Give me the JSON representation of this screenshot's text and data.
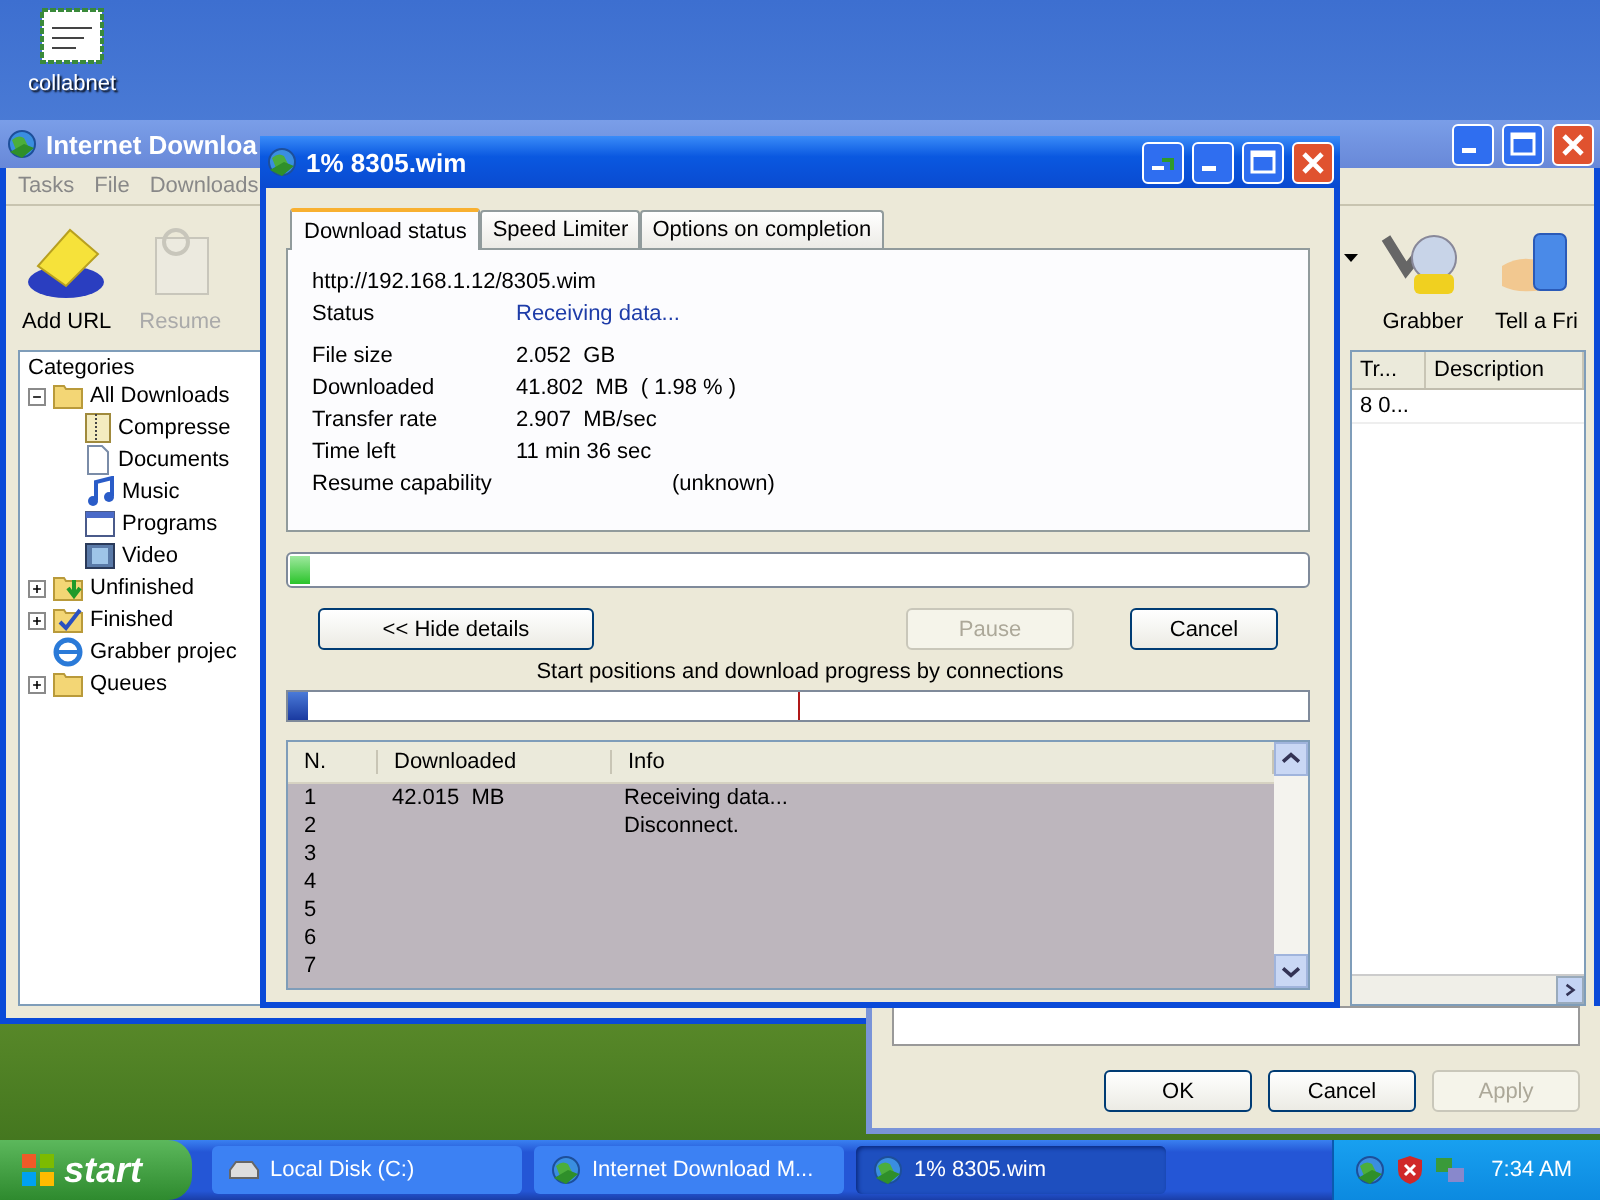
{
  "desktop_icons": [
    {
      "label": "collabnet"
    }
  ],
  "main_window": {
    "title": "Internet Downloa",
    "menu": [
      "Tasks",
      "File",
      "Downloads"
    ],
    "toolbar_left": [
      {
        "label": "Add URL",
        "disabled": false
      },
      {
        "label": "Resume",
        "disabled": true
      }
    ],
    "toolbar_right": [
      {
        "label": "Grabber",
        "disabled": false
      },
      {
        "label": "Tell a Fri",
        "disabled": false
      }
    ],
    "categories_title": "Categories",
    "tree": [
      {
        "label": "All Downloads",
        "expanded": true,
        "children": [
          {
            "label": "Compresse"
          },
          {
            "label": "Documents"
          },
          {
            "label": "Music"
          },
          {
            "label": "Programs"
          },
          {
            "label": "Video"
          }
        ]
      },
      {
        "label": "Unfinished",
        "expanded": false
      },
      {
        "label": "Finished",
        "expanded": false
      },
      {
        "label": "Grabber projec"
      },
      {
        "label": "Queues",
        "expanded": false
      }
    ],
    "list_columns": [
      "Tr...",
      "Description"
    ],
    "list_rows": [
      "8 0..."
    ]
  },
  "download_dialog": {
    "title": "1% 8305.wim",
    "tabs": [
      {
        "label": "Download status",
        "selected": true
      },
      {
        "label": "Speed Limiter",
        "selected": false
      },
      {
        "label": "Options on completion",
        "selected": false
      }
    ],
    "url": "http://192.168.1.12/8305.wim",
    "status_label": "Status",
    "status_value": "Receiving data...",
    "fields": [
      {
        "label": "File size",
        "value": "2.052  GB"
      },
      {
        "label": "Downloaded",
        "value": "41.802  MB  ( 1.98 % )"
      },
      {
        "label": "Transfer rate",
        "value": "2.907  MB/sec"
      },
      {
        "label": "Time left",
        "value": "11 min 36 sec"
      }
    ],
    "resume": {
      "label": "Resume capability",
      "value": "(unknown)"
    },
    "progress": {
      "level": 0.02
    },
    "buttons": [
      {
        "label": "<< Hide details",
        "disabled": false
      },
      {
        "label": "Pause",
        "disabled": true
      },
      {
        "label": "Cancel",
        "disabled": false
      }
    ],
    "connections_caption": "Start positions and download progress by connections",
    "connections_bar": {
      "level": 0.02
    },
    "table": {
      "columns": [
        "N.",
        "Downloaded",
        "Info"
      ],
      "rows": [
        {
          "n": "1",
          "downloaded": "42.015  MB",
          "info": "Receiving data..."
        },
        {
          "n": "2",
          "info": "Disconnect."
        },
        {
          "n": "3"
        },
        {
          "n": "4"
        },
        {
          "n": "5"
        },
        {
          "n": "6"
        },
        {
          "n": "7"
        }
      ]
    }
  },
  "options_dialog": {
    "buttons": [
      {
        "label": "OK",
        "disabled": false
      },
      {
        "label": "Cancel",
        "disabled": false
      },
      {
        "label": "Apply",
        "disabled": true
      }
    ]
  },
  "taskbar": {
    "start": "start",
    "tasks": [
      {
        "label": "Local Disk (C:)",
        "selected": false
      },
      {
        "label": "Internet Download M...",
        "selected": false
      },
      {
        "label": "1% 8305.wim",
        "selected": true
      }
    ],
    "clock": "7:34 AM"
  }
}
